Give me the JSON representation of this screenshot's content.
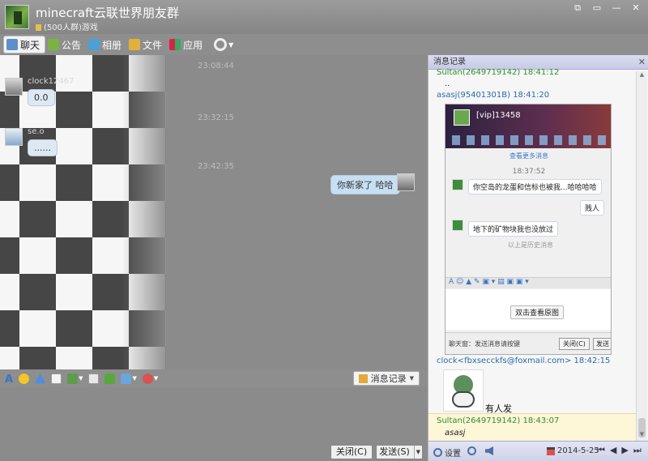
{
  "window": {
    "group_name": "minecraft云联世界朋友群",
    "group_sub": "(500人群)游戏",
    "controls": [
      "⧉",
      "▭",
      "—",
      "✕"
    ]
  },
  "tabs": [
    {
      "label": "聊天",
      "icon": "chat-icon",
      "active": true
    },
    {
      "label": "公告",
      "icon": "announcement-icon"
    },
    {
      "label": "相册",
      "icon": "album-icon"
    },
    {
      "label": "文件",
      "icon": "folder-icon"
    },
    {
      "label": "应用",
      "icon": "apps-icon"
    }
  ],
  "chat": {
    "ts_top": "23:08:44",
    "sender1": "clock12467",
    "msg1": "0.0",
    "ts1": "23:32:15",
    "sender2": "se.o",
    "msg2": "......",
    "ts2": "23:42:35",
    "msg_self": "你新家了 哈哈"
  },
  "input_toolbar": {
    "history_label": "消息记录"
  },
  "buttons": {
    "close": "关闭(C)",
    "send": "发送(S)"
  },
  "history": {
    "header": "消息记录",
    "close": "✕",
    "entry0_name": "Sultan(2649719142) 18:41:12",
    "entry0_msg": "..",
    "entry1_name": "asasj(95401301B) 18:41:20",
    "embed": {
      "title": "[vip]13458",
      "more": "查看更多消息",
      "time": "18:37:52",
      "m1": "你空岛的龙蛋和信标也被我...哈哈哈哈",
      "m2": "贱人",
      "m3": "地下的矿物块我也没放过",
      "divider": "以上是历史消息",
      "stamp": "双击查看原图",
      "footer": "聊天窗：发送消息请按键",
      "close": "关闭(C)",
      "send": "发送"
    },
    "entry2_name": "clock<fbxsecckfs@foxmail.com> 18:42:15",
    "caption": "有人发",
    "latest_name": "Sultan(2649719142) 18:43:07",
    "latest_msg": "asasj",
    "settings_label": "设置",
    "date": "2014-5-25",
    "navs": [
      "⏮",
      "◀",
      "▶",
      "⏭"
    ]
  }
}
